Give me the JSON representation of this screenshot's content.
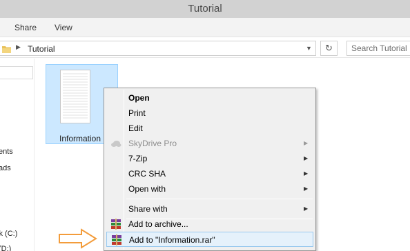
{
  "window": {
    "title": "Tutorial"
  },
  "ribbon": {
    "tabs": [
      "Share",
      "View"
    ]
  },
  "address": {
    "breadcrumb": "Tutorial",
    "search_placeholder": "Search Tutorial"
  },
  "navpane": {
    "items": [
      "ents",
      "ads",
      "sk (C:)",
      "(D:)"
    ]
  },
  "file": {
    "name": "Information.txt",
    "visible_name": "Information"
  },
  "context_menu": {
    "items": [
      {
        "label": "Open",
        "bold": true
      },
      {
        "label": "Print"
      },
      {
        "label": "Edit"
      },
      {
        "label": "SkyDrive Pro",
        "disabled": true,
        "submenu": true,
        "icon": "cloud-icon"
      },
      {
        "label": "7-Zip",
        "submenu": true
      },
      {
        "label": "CRC SHA",
        "submenu": true
      },
      {
        "label": "Open with",
        "submenu": true
      },
      {
        "label": "Share with",
        "submenu": true
      },
      {
        "label": "Add to archive...",
        "icon": "winrar-icon"
      },
      {
        "label": "Add to \"Information.rar\"",
        "icon": "winrar-icon",
        "highlighted": true
      }
    ]
  },
  "colors": {
    "accent": "#99c9ef",
    "selection": "#cce8ff",
    "hint_arrow": "#f39c3b"
  }
}
